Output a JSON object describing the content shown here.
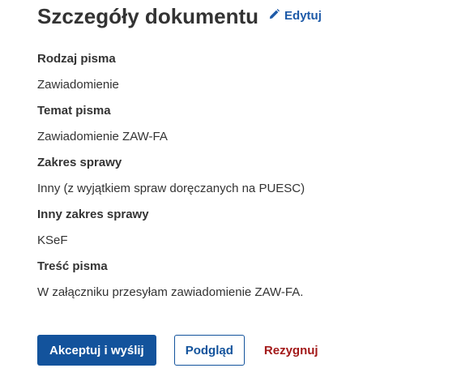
{
  "header": {
    "title": "Szczegóły dokumentu",
    "edit_label": "Edytuj",
    "edit_icon": "pencil-icon"
  },
  "fields": [
    {
      "label": "Rodzaj pisma",
      "value": "Zawiadomienie"
    },
    {
      "label": "Temat pisma",
      "value": "Zawiadomienie ZAW-FA"
    },
    {
      "label": "Zakres sprawy",
      "value": "Inny (z wyjątkiem spraw doręczanych na PUESC)"
    },
    {
      "label": "Inny zakres sprawy",
      "value": "KSeF"
    },
    {
      "label": "Treść pisma",
      "value": "W załączniku przesyłam zawiadomienie ZAW-FA."
    }
  ],
  "actions": {
    "primary_label": "Akceptuj i wyślij",
    "secondary_label": "Podgląd",
    "cancel_label": "Rezygnuj"
  },
  "colors": {
    "primary": "#13539c",
    "link": "#1d5aa8",
    "danger": "#a31a1a",
    "text": "#333333"
  }
}
